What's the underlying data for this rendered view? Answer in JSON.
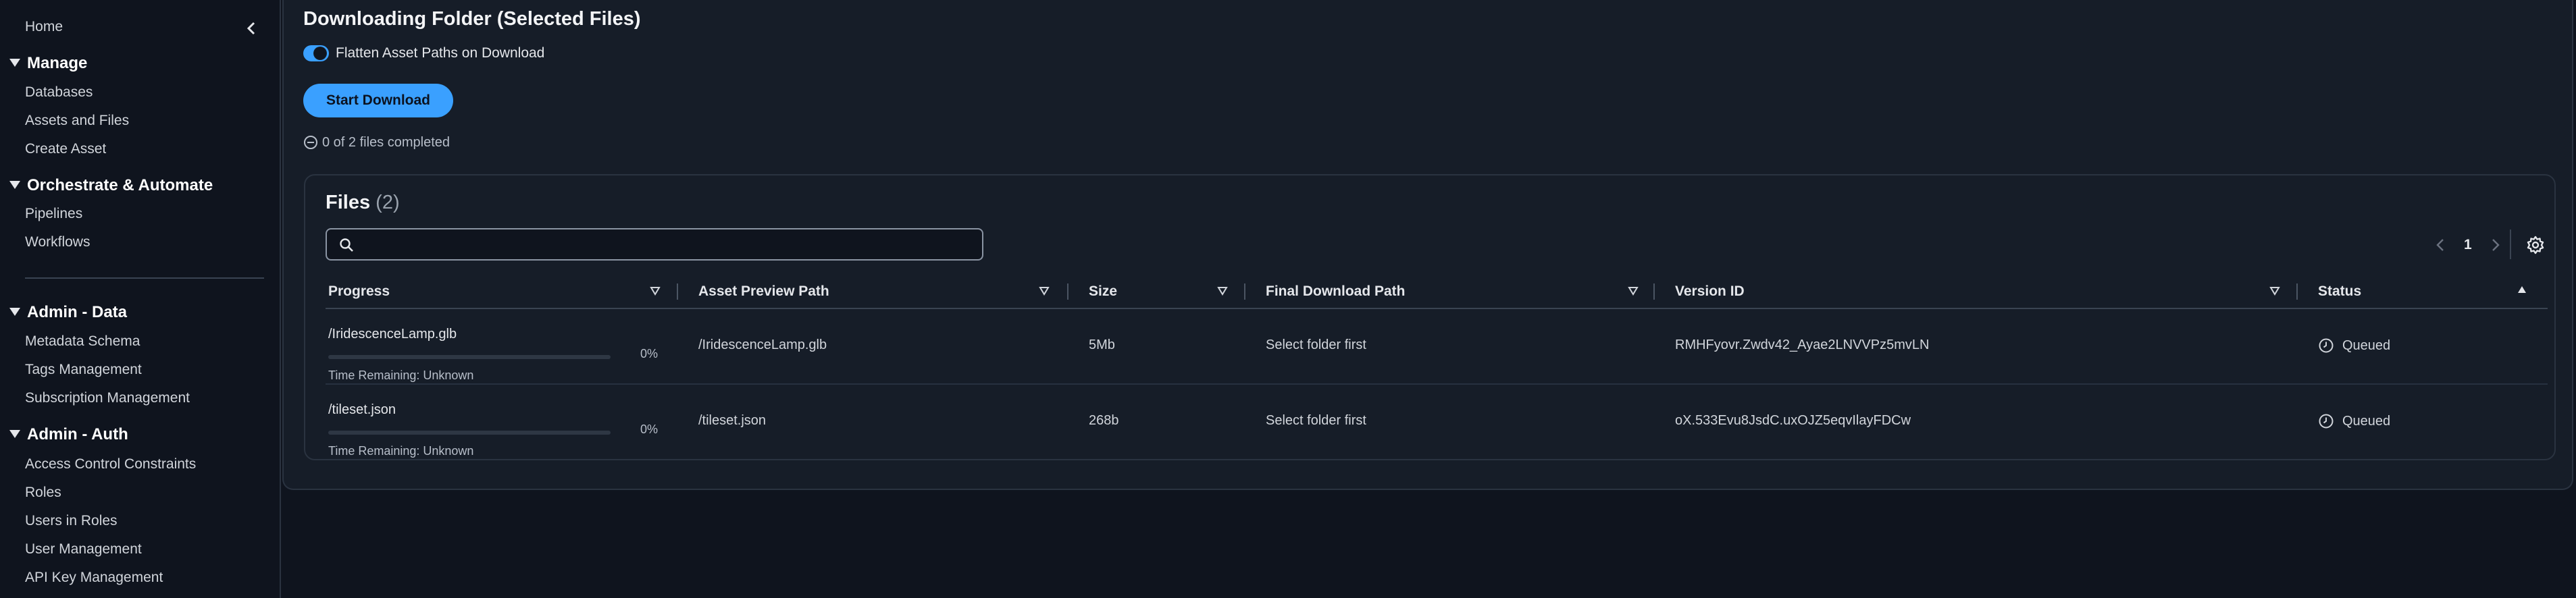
{
  "sidebar": {
    "home": "Home",
    "sections": [
      {
        "title": "Manage",
        "items": [
          "Databases",
          "Assets and Files",
          "Create Asset"
        ]
      },
      {
        "title": "Orchestrate & Automate",
        "items": [
          "Pipelines",
          "Workflows"
        ]
      },
      {
        "title": "Admin - Data",
        "items": [
          "Metadata Schema",
          "Tags Management",
          "Subscription Management"
        ]
      },
      {
        "title": "Admin - Auth",
        "items": [
          "Access Control Constraints",
          "Roles",
          "Users in Roles",
          "User Management",
          "API Key Management"
        ]
      }
    ]
  },
  "main": {
    "title": "Downloading Folder (Selected Files)",
    "toggle_label": "Flatten Asset Paths on Download",
    "toggle_on": true,
    "start_button": "Start Download",
    "files_status": "0 of 2 files completed"
  },
  "files": {
    "heading": "Files",
    "count": "(2)",
    "search_placeholder": "",
    "page": "1",
    "columns": [
      "Progress",
      "Asset Preview Path",
      "Size",
      "Final Download Path",
      "Version ID",
      "Status"
    ],
    "rows": [
      {
        "name": "/IridescenceLamp.glb",
        "progress": 0,
        "percent": "0%",
        "remaining": "Time Remaining: Unknown",
        "preview_path": "/IridescenceLamp.glb",
        "size": "5Mb",
        "final_path": "Select folder first",
        "version_id": "RMHFyovr.Zwdv42_Ayae2LNVVPz5mvLN",
        "status": "Queued"
      },
      {
        "name": "/tileset.json",
        "progress": 0,
        "percent": "0%",
        "remaining": "Time Remaining: Unknown",
        "preview_path": "/tileset.json",
        "size": "268b",
        "final_path": "Select folder first",
        "version_id": "oX.533Evu8JsdC.uxOJZ5eqvIlayFDCw",
        "status": "Queued"
      }
    ]
  },
  "colors": {
    "accent": "#3aa0ff",
    "background": "#0f141e",
    "panel": "#161d28"
  }
}
